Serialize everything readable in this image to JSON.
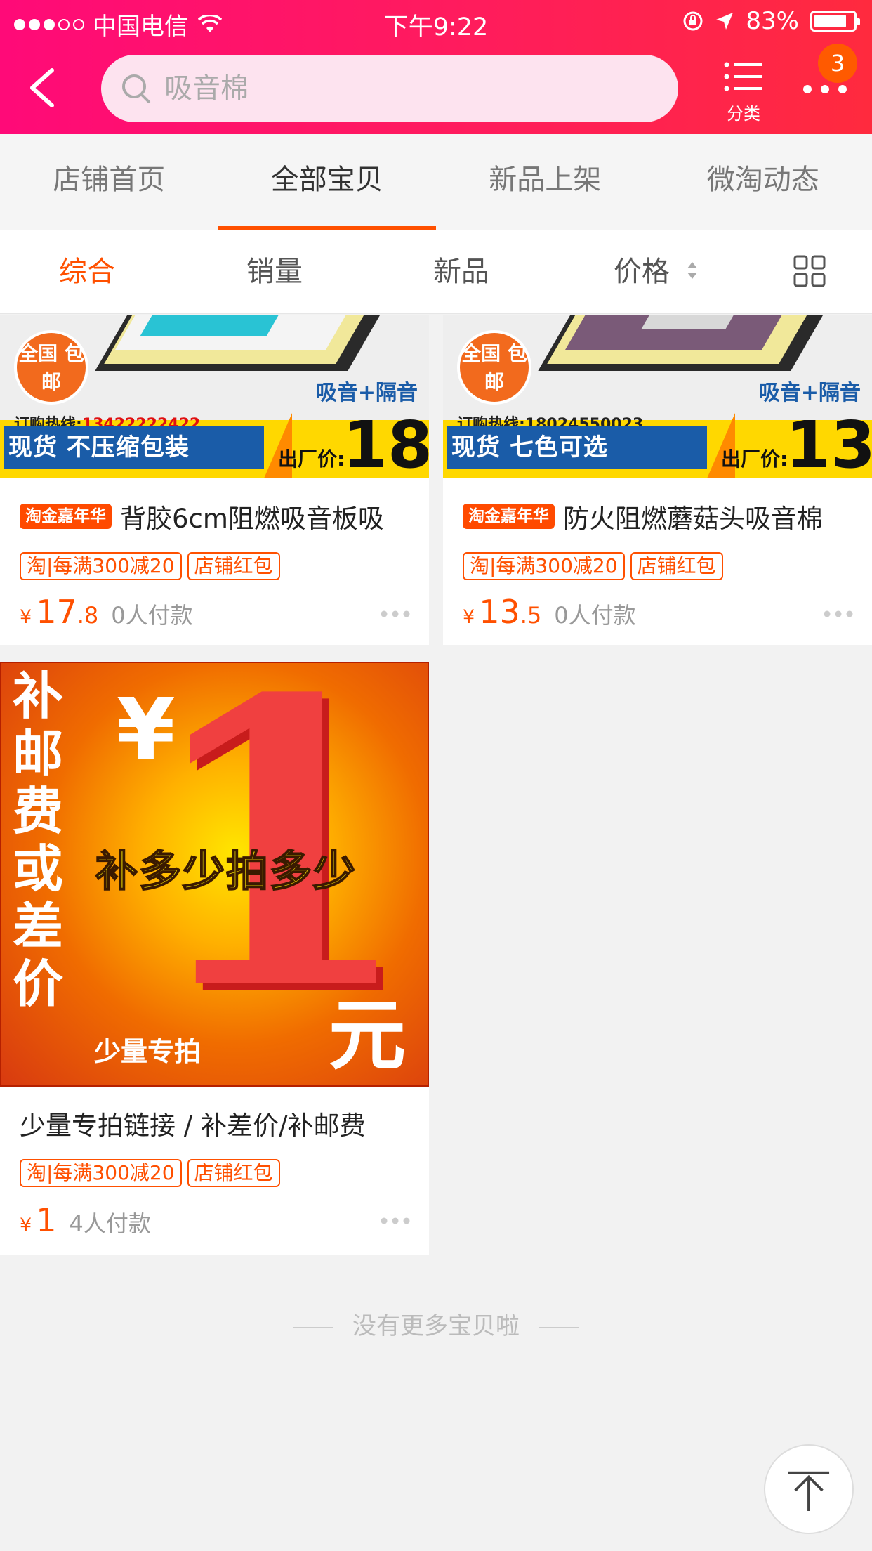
{
  "status_bar": {
    "carrier": "中国电信",
    "time": "下午9:22",
    "battery": "83%",
    "battery_level": 0.83
  },
  "nav": {
    "search_placeholder": "吸音棉",
    "category_label": "分类",
    "badge_count": "3"
  },
  "shop_tabs": [
    {
      "label": "店铺首页",
      "active": false
    },
    {
      "label": "全部宝贝",
      "active": true
    },
    {
      "label": "新品上架",
      "active": false
    },
    {
      "label": "微淘动态",
      "active": false
    }
  ],
  "sort_bar": {
    "items": [
      "综合",
      "销量",
      "新品",
      "价格"
    ],
    "active": "综合"
  },
  "products": [
    {
      "campaign_badge": "淘金嘉年华",
      "title": "背胶6cm阻燃吸音板吸",
      "tags": [
        "淘|每满300减20",
        "店铺红包"
      ],
      "currency": "¥",
      "price_int": "17",
      "price_dec": ".8",
      "sold": "0人付款",
      "image": {
        "free_shipping": "全国 包邮",
        "feature": "吸音+隔音",
        "hotline_label": "订购热线:",
        "hotline": "13422222422",
        "strip_text": "现货 不压缩包装",
        "factory_label": "出厂价:",
        "factory_price": "18"
      }
    },
    {
      "campaign_badge": "淘金嘉年华",
      "title": "防火阻燃蘑菇头吸音棉",
      "tags": [
        "淘|每满300减20",
        "店铺红包"
      ],
      "currency": "¥",
      "price_int": "13",
      "price_dec": ".5",
      "sold": "0人付款",
      "image": {
        "free_shipping": "全国 包邮",
        "feature": "吸音+隔音",
        "hotline_label": "订购热线:",
        "hotline": "18024550023",
        "strip_text": "现货 七色可选",
        "factory_label": "出厂价:",
        "factory_price": "13"
      }
    },
    {
      "title": "少量专拍链接 / 补差价/补邮费",
      "tags": [
        "淘|每满300减20",
        "店铺红包"
      ],
      "currency": "¥",
      "price_int": "1",
      "price_dec": "",
      "sold": "4人付款",
      "image": {
        "vertical_text": "补邮费或差价",
        "yen": "¥",
        "big_number": "1",
        "slogan": "补多少拍多少",
        "unit": "元",
        "footnote": "少量专拍"
      }
    }
  ],
  "end_text": "没有更多宝贝啦",
  "colors": {
    "header_start": "#ff0a78",
    "header_end": "#ff2a3e",
    "accent": "#ff5000",
    "badge": "#ff5a00"
  },
  "icons": [
    "back-chevron-icon",
    "search-icon",
    "category-list-icon",
    "more-dots-icon",
    "sort-arrows-icon",
    "grid-view-icon",
    "back-to-top-icon"
  ]
}
